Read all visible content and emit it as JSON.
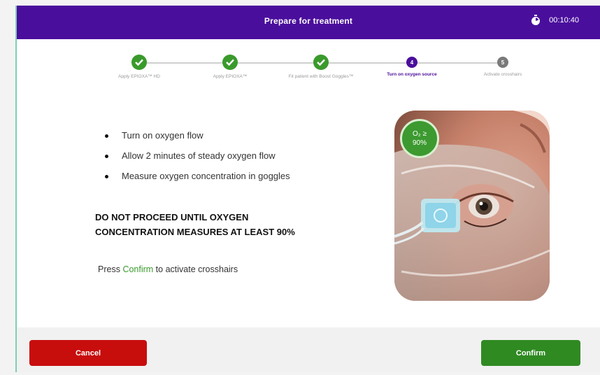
{
  "header": {
    "title": "Prepare for treatment",
    "timer": "00:10:40"
  },
  "stepper": {
    "steps": [
      {
        "number": "1",
        "label": "Apply EPIOXA™ HD",
        "state": "done"
      },
      {
        "number": "2",
        "label": "Apply EPIOXA™",
        "state": "done"
      },
      {
        "number": "3",
        "label": "Fit patient with Boost Goggles™",
        "state": "done"
      },
      {
        "number": "4",
        "label": "Turn on oxygen source",
        "state": "active"
      },
      {
        "number": "5",
        "label": "Activate crosshairs",
        "state": "pending"
      }
    ]
  },
  "instructions": {
    "bullets": [
      "Turn on oxygen flow",
      "Allow 2 minutes of steady oxygen flow",
      "Measure oxygen concentration in goggles"
    ],
    "warning_line1": "DO NOT PROCEED UNTIL OXYGEN",
    "warning_line2": "CONCENTRATION MEASURES AT LEAST 90%",
    "press_prefix": "Press ",
    "press_confirm": "Confirm",
    "press_suffix": " to activate crosshairs"
  },
  "photo": {
    "badge_line1": "O₂ ≥",
    "badge_line2": "90%"
  },
  "footer": {
    "cancel_label": "Cancel",
    "confirm_label": "Confirm"
  },
  "colors": {
    "header": "#4a0e9c",
    "done": "#3a9a2c",
    "cancel": "#c80d0d",
    "confirm": "#2f8a22"
  }
}
